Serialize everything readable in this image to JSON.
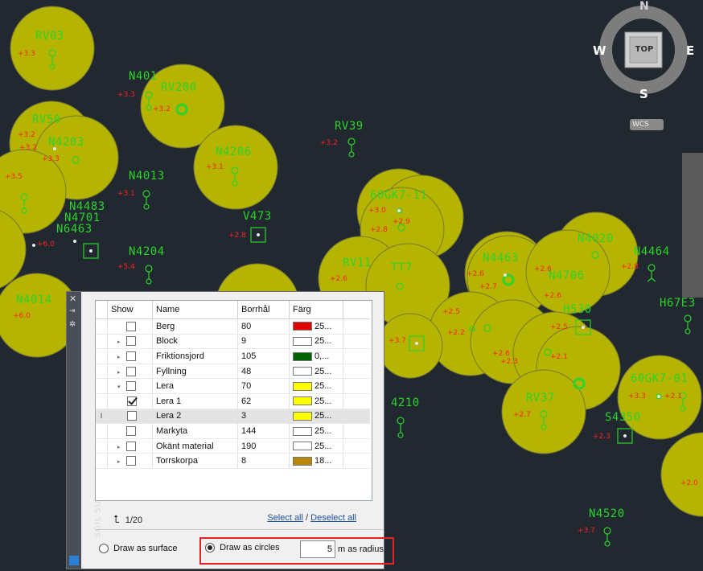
{
  "viewcube": {
    "north": "N",
    "west": "W",
    "east": "E",
    "south": "S",
    "top": "TOP",
    "ucs": "WCS"
  },
  "drawing_labels": [
    {
      "text": "RV03"
    },
    {
      "text": "N401"
    },
    {
      "text": "RV200"
    },
    {
      "text": "RV39"
    },
    {
      "text": "RV50"
    },
    {
      "text": "N4203"
    },
    {
      "text": "N4206"
    },
    {
      "text": "N4013"
    },
    {
      "text": "N4483"
    },
    {
      "text": "N4701"
    },
    {
      "text": "N6463"
    },
    {
      "text": "V473"
    },
    {
      "text": "N4204"
    },
    {
      "text": "N4014"
    },
    {
      "text": "60GK7-11"
    },
    {
      "text": "N4020"
    },
    {
      "text": "N4464"
    },
    {
      "text": "N4463"
    },
    {
      "text": "H67E3"
    },
    {
      "text": "RV11"
    },
    {
      "text": "TT7"
    },
    {
      "text": "N4706"
    },
    {
      "text": "H530"
    },
    {
      "text": "RV37"
    },
    {
      "text": "60GK7-01"
    },
    {
      "text": "S4350"
    },
    {
      "text": "N4520"
    },
    {
      "text": "4210"
    }
  ],
  "elevation_labels": [
    {
      "text": "+3.3"
    },
    {
      "text": "+3.3"
    },
    {
      "text": "+3.2"
    },
    {
      "text": "+3.2"
    },
    {
      "text": "+3.2"
    },
    {
      "text": "+3.2"
    },
    {
      "text": "+3.3"
    },
    {
      "text": "+3.1"
    },
    {
      "text": "+3.1"
    },
    {
      "text": "+3.5"
    },
    {
      "text": "+6.0"
    },
    {
      "text": "+2.8"
    },
    {
      "text": "+5.4"
    },
    {
      "text": "+6.0"
    },
    {
      "text": "+3.0"
    },
    {
      "text": "+2.9"
    },
    {
      "text": "+2.8"
    },
    {
      "text": "+2.6"
    },
    {
      "text": "+2.6"
    },
    {
      "text": "+2.7"
    },
    {
      "text": "+2.6"
    },
    {
      "text": "+2.6"
    },
    {
      "text": "+2.5"
    },
    {
      "text": "+2.2"
    },
    {
      "text": "+2.5"
    },
    {
      "text": "+2.6"
    },
    {
      "text": "+2.3"
    },
    {
      "text": "+2.1"
    },
    {
      "text": "+3.3"
    },
    {
      "text": "+2.1"
    },
    {
      "text": "+2.7"
    },
    {
      "text": "+2.3"
    },
    {
      "text": "+3.7"
    },
    {
      "text": "+2.0"
    },
    {
      "text": "+3.7"
    },
    {
      "text": "+2.8"
    }
  ],
  "panel": {
    "title": "SOIL SURFACES",
    "columns": {
      "show": "Show",
      "name": "Name",
      "count": "Borrhål",
      "color": "Färg"
    },
    "rows": [
      {
        "expand": "",
        "checked": false,
        "indent": 0,
        "name": "Berg",
        "count": "80",
        "color": "#e00000",
        "color_text": "25..."
      },
      {
        "expand": "▸",
        "checked": false,
        "indent": 0,
        "name": "Block",
        "count": "9",
        "color": "#ffffff",
        "color_text": "25..."
      },
      {
        "expand": "▸",
        "checked": false,
        "indent": 0,
        "name": "Friktionsjord",
        "count": "105",
        "color": "#006400",
        "color_text": "0,..."
      },
      {
        "expand": "▸",
        "checked": false,
        "indent": 0,
        "name": "Fyllning",
        "count": "48",
        "color": "#ffffff",
        "color_text": "25..."
      },
      {
        "expand": "▾",
        "checked": false,
        "indent": 0,
        "name": "Lera",
        "count": "70",
        "color": "#ffff00",
        "color_text": "25..."
      },
      {
        "expand": "",
        "checked": true,
        "indent": 1,
        "name": "Lera 1",
        "count": "62",
        "color": "#ffff00",
        "color_text": "25..."
      },
      {
        "expand": "",
        "checked": false,
        "indent": 1,
        "name": "Lera 2",
        "count": "3",
        "color": "#ffff00",
        "color_text": "25...",
        "selected": true,
        "cursor": "I"
      },
      {
        "expand": "",
        "checked": false,
        "indent": 0,
        "name": "Markyta",
        "count": "144",
        "color": "#ffffff",
        "color_text": "25..."
      },
      {
        "expand": "▸",
        "checked": false,
        "indent": 0,
        "name": "Okänt material",
        "count": "190",
        "color": "#ffffff",
        "color_text": "25..."
      },
      {
        "expand": "▸",
        "checked": false,
        "indent": 0,
        "name": "Torrskorpa",
        "count": "8",
        "color": "#b8860b",
        "color_text": "18..."
      }
    ],
    "pager": "1/20",
    "select_all": "Select all",
    "link_separator": "/",
    "deselect_all": "Deselect all",
    "draw_surface": "Draw as surface",
    "draw_circles": "Draw as circles",
    "mode": "circles",
    "radius_value": "5",
    "radius_suffix": "m as radius."
  }
}
